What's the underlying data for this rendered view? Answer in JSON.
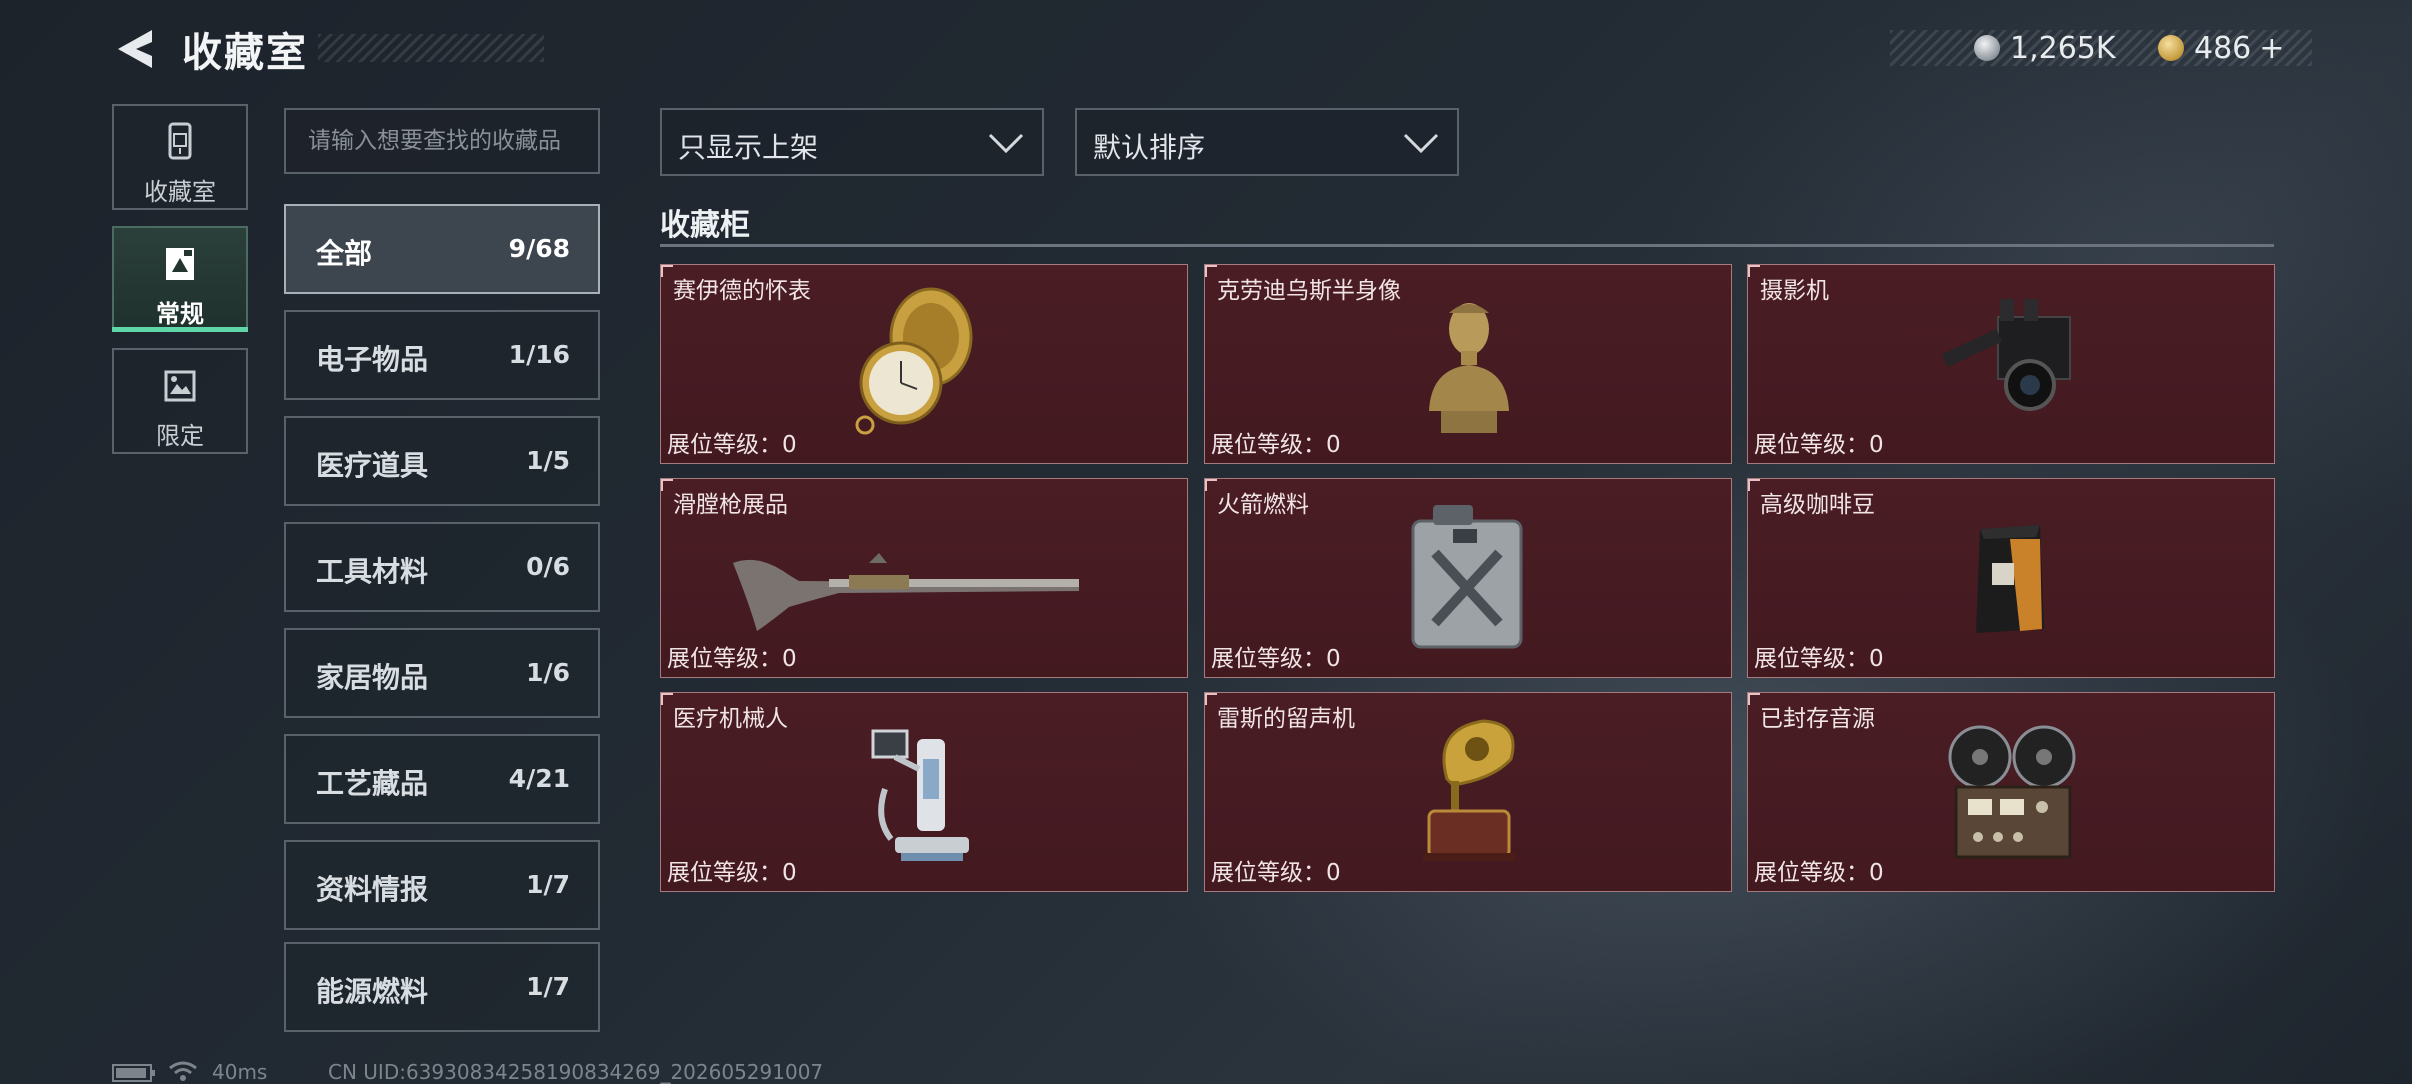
{
  "header": {
    "title": "收藏室",
    "currency_silver": "1,265K",
    "currency_gold": "486",
    "currency_add": "+"
  },
  "left_nav": [
    {
      "label": "收藏室",
      "icon": "phone-booth-icon",
      "active": false
    },
    {
      "label": "常规",
      "icon": "framed-picture-icon",
      "active": true
    },
    {
      "label": "限定",
      "icon": "landscape-frame-icon",
      "active": false
    }
  ],
  "search": {
    "placeholder": "请输入想要查找的收藏品",
    "value": ""
  },
  "categories": [
    {
      "label": "全部",
      "count": "9/68",
      "active": true
    },
    {
      "label": "电子物品",
      "count": "1/16"
    },
    {
      "label": "医疗道具",
      "count": "1/5"
    },
    {
      "label": "工具材料",
      "count": "0/6"
    },
    {
      "label": "家居物品",
      "count": "1/6"
    },
    {
      "label": "工艺藏品",
      "count": "4/21"
    },
    {
      "label": "资料情报",
      "count": "1/7"
    },
    {
      "label": "能源燃料",
      "count": "1/7"
    }
  ],
  "filters": {
    "show_filter": "只显示上架",
    "sort": "默认排序"
  },
  "section": {
    "title": "收藏柜"
  },
  "items": [
    {
      "name": "赛伊德的怀表",
      "level": "展位等级：0",
      "icon": "pocket-watch-icon"
    },
    {
      "name": "克劳迪乌斯半身像",
      "level": "展位等级：0",
      "icon": "bust-statue-icon"
    },
    {
      "name": "摄影机",
      "level": "展位等级：0",
      "icon": "video-camera-icon"
    },
    {
      "name": "滑膛枪展品",
      "level": "展位等级：0",
      "icon": "musket-icon"
    },
    {
      "name": "火箭燃料",
      "level": "展位等级：0",
      "icon": "fuel-canister-icon"
    },
    {
      "name": "高级咖啡豆",
      "level": "展位等级：0",
      "icon": "coffee-bag-icon"
    },
    {
      "name": "医疗机械人",
      "level": "展位等级：0",
      "icon": "medical-robot-icon"
    },
    {
      "name": "雷斯的留声机",
      "level": "展位等级：0",
      "icon": "gramophone-icon"
    },
    {
      "name": "已封存音源",
      "level": "展位等级：0",
      "icon": "reel-recorder-icon"
    }
  ],
  "footer": {
    "ping": "40ms",
    "uid": "CN UID:63930834258190834269_202605291007"
  }
}
